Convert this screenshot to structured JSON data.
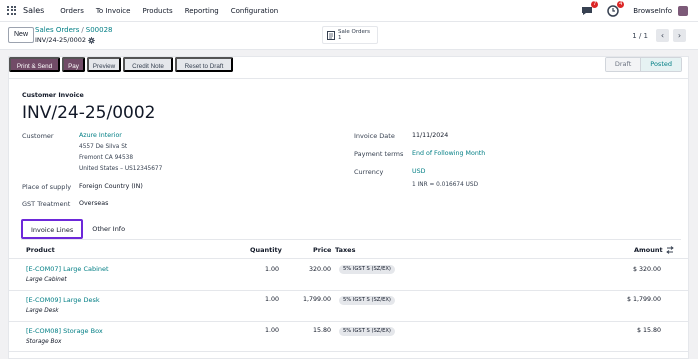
{
  "topnav": {
    "app_name": "Sales",
    "menus": [
      "Orders",
      "To Invoice",
      "Products",
      "Reporting",
      "Configuration"
    ],
    "chat_count": "7",
    "activity_count": "4",
    "company": "BrowseInfo"
  },
  "control": {
    "new_label": "New",
    "breadcrumb": [
      "Sales Orders",
      "S00028"
    ],
    "record_name": "INV/24-25/0002",
    "smart_button": {
      "label": "Sale Orders",
      "count": "1"
    },
    "pager": "1 / 1"
  },
  "actions": {
    "print_send": "Print & Send",
    "pay": "Pay",
    "preview": "Preview",
    "credit_note": "Credit Note",
    "reset": "Reset to Draft"
  },
  "statusbar": [
    "Draft",
    "Posted"
  ],
  "invoice": {
    "doc_type": "Customer Invoice",
    "number": "INV/24-25/0002",
    "customer_label": "Customer",
    "customer_name": "Azure Interior",
    "address": [
      "4557 De Silva St",
      "Fremont CA 94538",
      "United States – US12345677"
    ],
    "place_label": "Place of supply",
    "place_value": "Foreign Country (IN)",
    "gst_label": "GST Treatment",
    "gst_value": "Overseas",
    "date_label": "Invoice Date",
    "date_value": "11/11/2024",
    "terms_label": "Payment terms",
    "terms_value": "End of Following Month",
    "currency_label": "Currency",
    "currency_value": "USD",
    "rate": "1 INR = 0.016674 USD"
  },
  "tabs": [
    "Invoice Lines",
    "Other Info"
  ],
  "lines": {
    "headers": {
      "product": "Product",
      "quantity": "Quantity",
      "price": "Price",
      "taxes": "Taxes",
      "amount": "Amount"
    },
    "rows": [
      {
        "product": "[E-COM07] Large Cabinet",
        "desc": "Large Cabinet",
        "qty": "1.00",
        "price": "320.00",
        "tax": "5% IGST S (SZ/EX)",
        "amount": "$ 320.00"
      },
      {
        "product": "[E-COM09] Large Desk",
        "desc": "Large Desk",
        "qty": "1.00",
        "price": "1,799.00",
        "tax": "5% IGST S (SZ/EX)",
        "amount": "$ 1,799.00"
      },
      {
        "product": "[E-COM08] Storage Box",
        "desc": "Storage Box",
        "qty": "1.00",
        "price": "15.80",
        "tax": "5% IGST S (SZ/EX)",
        "amount": "$ 15.80"
      }
    ]
  },
  "colors": {
    "brand": "#714b67",
    "link": "#017e84",
    "tab_highlight": "#6d28d9"
  },
  "icons": [
    "apps-grid-icon",
    "chat-icon",
    "activity-clock-icon",
    "gear-icon",
    "invoice-icon",
    "chevron-left-icon",
    "chevron-right-icon",
    "column-settings-icon"
  ]
}
